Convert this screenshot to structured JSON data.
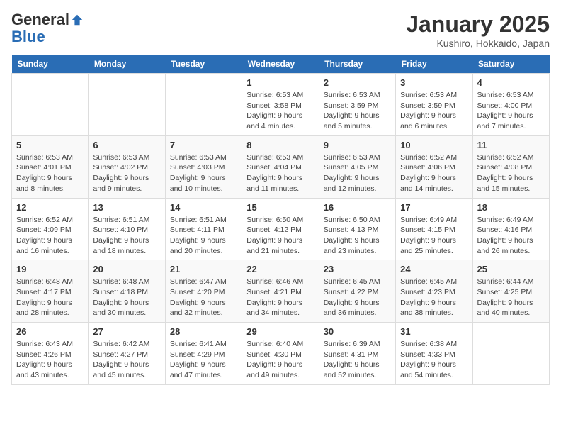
{
  "header": {
    "logo_general": "General",
    "logo_blue": "Blue",
    "month_title": "January 2025",
    "location": "Kushiro, Hokkaido, Japan"
  },
  "weekdays": [
    "Sunday",
    "Monday",
    "Tuesday",
    "Wednesday",
    "Thursday",
    "Friday",
    "Saturday"
  ],
  "weeks": [
    [
      {
        "day": "",
        "info": ""
      },
      {
        "day": "",
        "info": ""
      },
      {
        "day": "",
        "info": ""
      },
      {
        "day": "1",
        "info": "Sunrise: 6:53 AM\nSunset: 3:58 PM\nDaylight: 9 hours and 4 minutes."
      },
      {
        "day": "2",
        "info": "Sunrise: 6:53 AM\nSunset: 3:59 PM\nDaylight: 9 hours and 5 minutes."
      },
      {
        "day": "3",
        "info": "Sunrise: 6:53 AM\nSunset: 3:59 PM\nDaylight: 9 hours and 6 minutes."
      },
      {
        "day": "4",
        "info": "Sunrise: 6:53 AM\nSunset: 4:00 PM\nDaylight: 9 hours and 7 minutes."
      }
    ],
    [
      {
        "day": "5",
        "info": "Sunrise: 6:53 AM\nSunset: 4:01 PM\nDaylight: 9 hours and 8 minutes."
      },
      {
        "day": "6",
        "info": "Sunrise: 6:53 AM\nSunset: 4:02 PM\nDaylight: 9 hours and 9 minutes."
      },
      {
        "day": "7",
        "info": "Sunrise: 6:53 AM\nSunset: 4:03 PM\nDaylight: 9 hours and 10 minutes."
      },
      {
        "day": "8",
        "info": "Sunrise: 6:53 AM\nSunset: 4:04 PM\nDaylight: 9 hours and 11 minutes."
      },
      {
        "day": "9",
        "info": "Sunrise: 6:53 AM\nSunset: 4:05 PM\nDaylight: 9 hours and 12 minutes."
      },
      {
        "day": "10",
        "info": "Sunrise: 6:52 AM\nSunset: 4:06 PM\nDaylight: 9 hours and 14 minutes."
      },
      {
        "day": "11",
        "info": "Sunrise: 6:52 AM\nSunset: 4:08 PM\nDaylight: 9 hours and 15 minutes."
      }
    ],
    [
      {
        "day": "12",
        "info": "Sunrise: 6:52 AM\nSunset: 4:09 PM\nDaylight: 9 hours and 16 minutes."
      },
      {
        "day": "13",
        "info": "Sunrise: 6:51 AM\nSunset: 4:10 PM\nDaylight: 9 hours and 18 minutes."
      },
      {
        "day": "14",
        "info": "Sunrise: 6:51 AM\nSunset: 4:11 PM\nDaylight: 9 hours and 20 minutes."
      },
      {
        "day": "15",
        "info": "Sunrise: 6:50 AM\nSunset: 4:12 PM\nDaylight: 9 hours and 21 minutes."
      },
      {
        "day": "16",
        "info": "Sunrise: 6:50 AM\nSunset: 4:13 PM\nDaylight: 9 hours and 23 minutes."
      },
      {
        "day": "17",
        "info": "Sunrise: 6:49 AM\nSunset: 4:15 PM\nDaylight: 9 hours and 25 minutes."
      },
      {
        "day": "18",
        "info": "Sunrise: 6:49 AM\nSunset: 4:16 PM\nDaylight: 9 hours and 26 minutes."
      }
    ],
    [
      {
        "day": "19",
        "info": "Sunrise: 6:48 AM\nSunset: 4:17 PM\nDaylight: 9 hours and 28 minutes."
      },
      {
        "day": "20",
        "info": "Sunrise: 6:48 AM\nSunset: 4:18 PM\nDaylight: 9 hours and 30 minutes."
      },
      {
        "day": "21",
        "info": "Sunrise: 6:47 AM\nSunset: 4:20 PM\nDaylight: 9 hours and 32 minutes."
      },
      {
        "day": "22",
        "info": "Sunrise: 6:46 AM\nSunset: 4:21 PM\nDaylight: 9 hours and 34 minutes."
      },
      {
        "day": "23",
        "info": "Sunrise: 6:45 AM\nSunset: 4:22 PM\nDaylight: 9 hours and 36 minutes."
      },
      {
        "day": "24",
        "info": "Sunrise: 6:45 AM\nSunset: 4:23 PM\nDaylight: 9 hours and 38 minutes."
      },
      {
        "day": "25",
        "info": "Sunrise: 6:44 AM\nSunset: 4:25 PM\nDaylight: 9 hours and 40 minutes."
      }
    ],
    [
      {
        "day": "26",
        "info": "Sunrise: 6:43 AM\nSunset: 4:26 PM\nDaylight: 9 hours and 43 minutes."
      },
      {
        "day": "27",
        "info": "Sunrise: 6:42 AM\nSunset: 4:27 PM\nDaylight: 9 hours and 45 minutes."
      },
      {
        "day": "28",
        "info": "Sunrise: 6:41 AM\nSunset: 4:29 PM\nDaylight: 9 hours and 47 minutes."
      },
      {
        "day": "29",
        "info": "Sunrise: 6:40 AM\nSunset: 4:30 PM\nDaylight: 9 hours and 49 minutes."
      },
      {
        "day": "30",
        "info": "Sunrise: 6:39 AM\nSunset: 4:31 PM\nDaylight: 9 hours and 52 minutes."
      },
      {
        "day": "31",
        "info": "Sunrise: 6:38 AM\nSunset: 4:33 PM\nDaylight: 9 hours and 54 minutes."
      },
      {
        "day": "",
        "info": ""
      }
    ]
  ]
}
